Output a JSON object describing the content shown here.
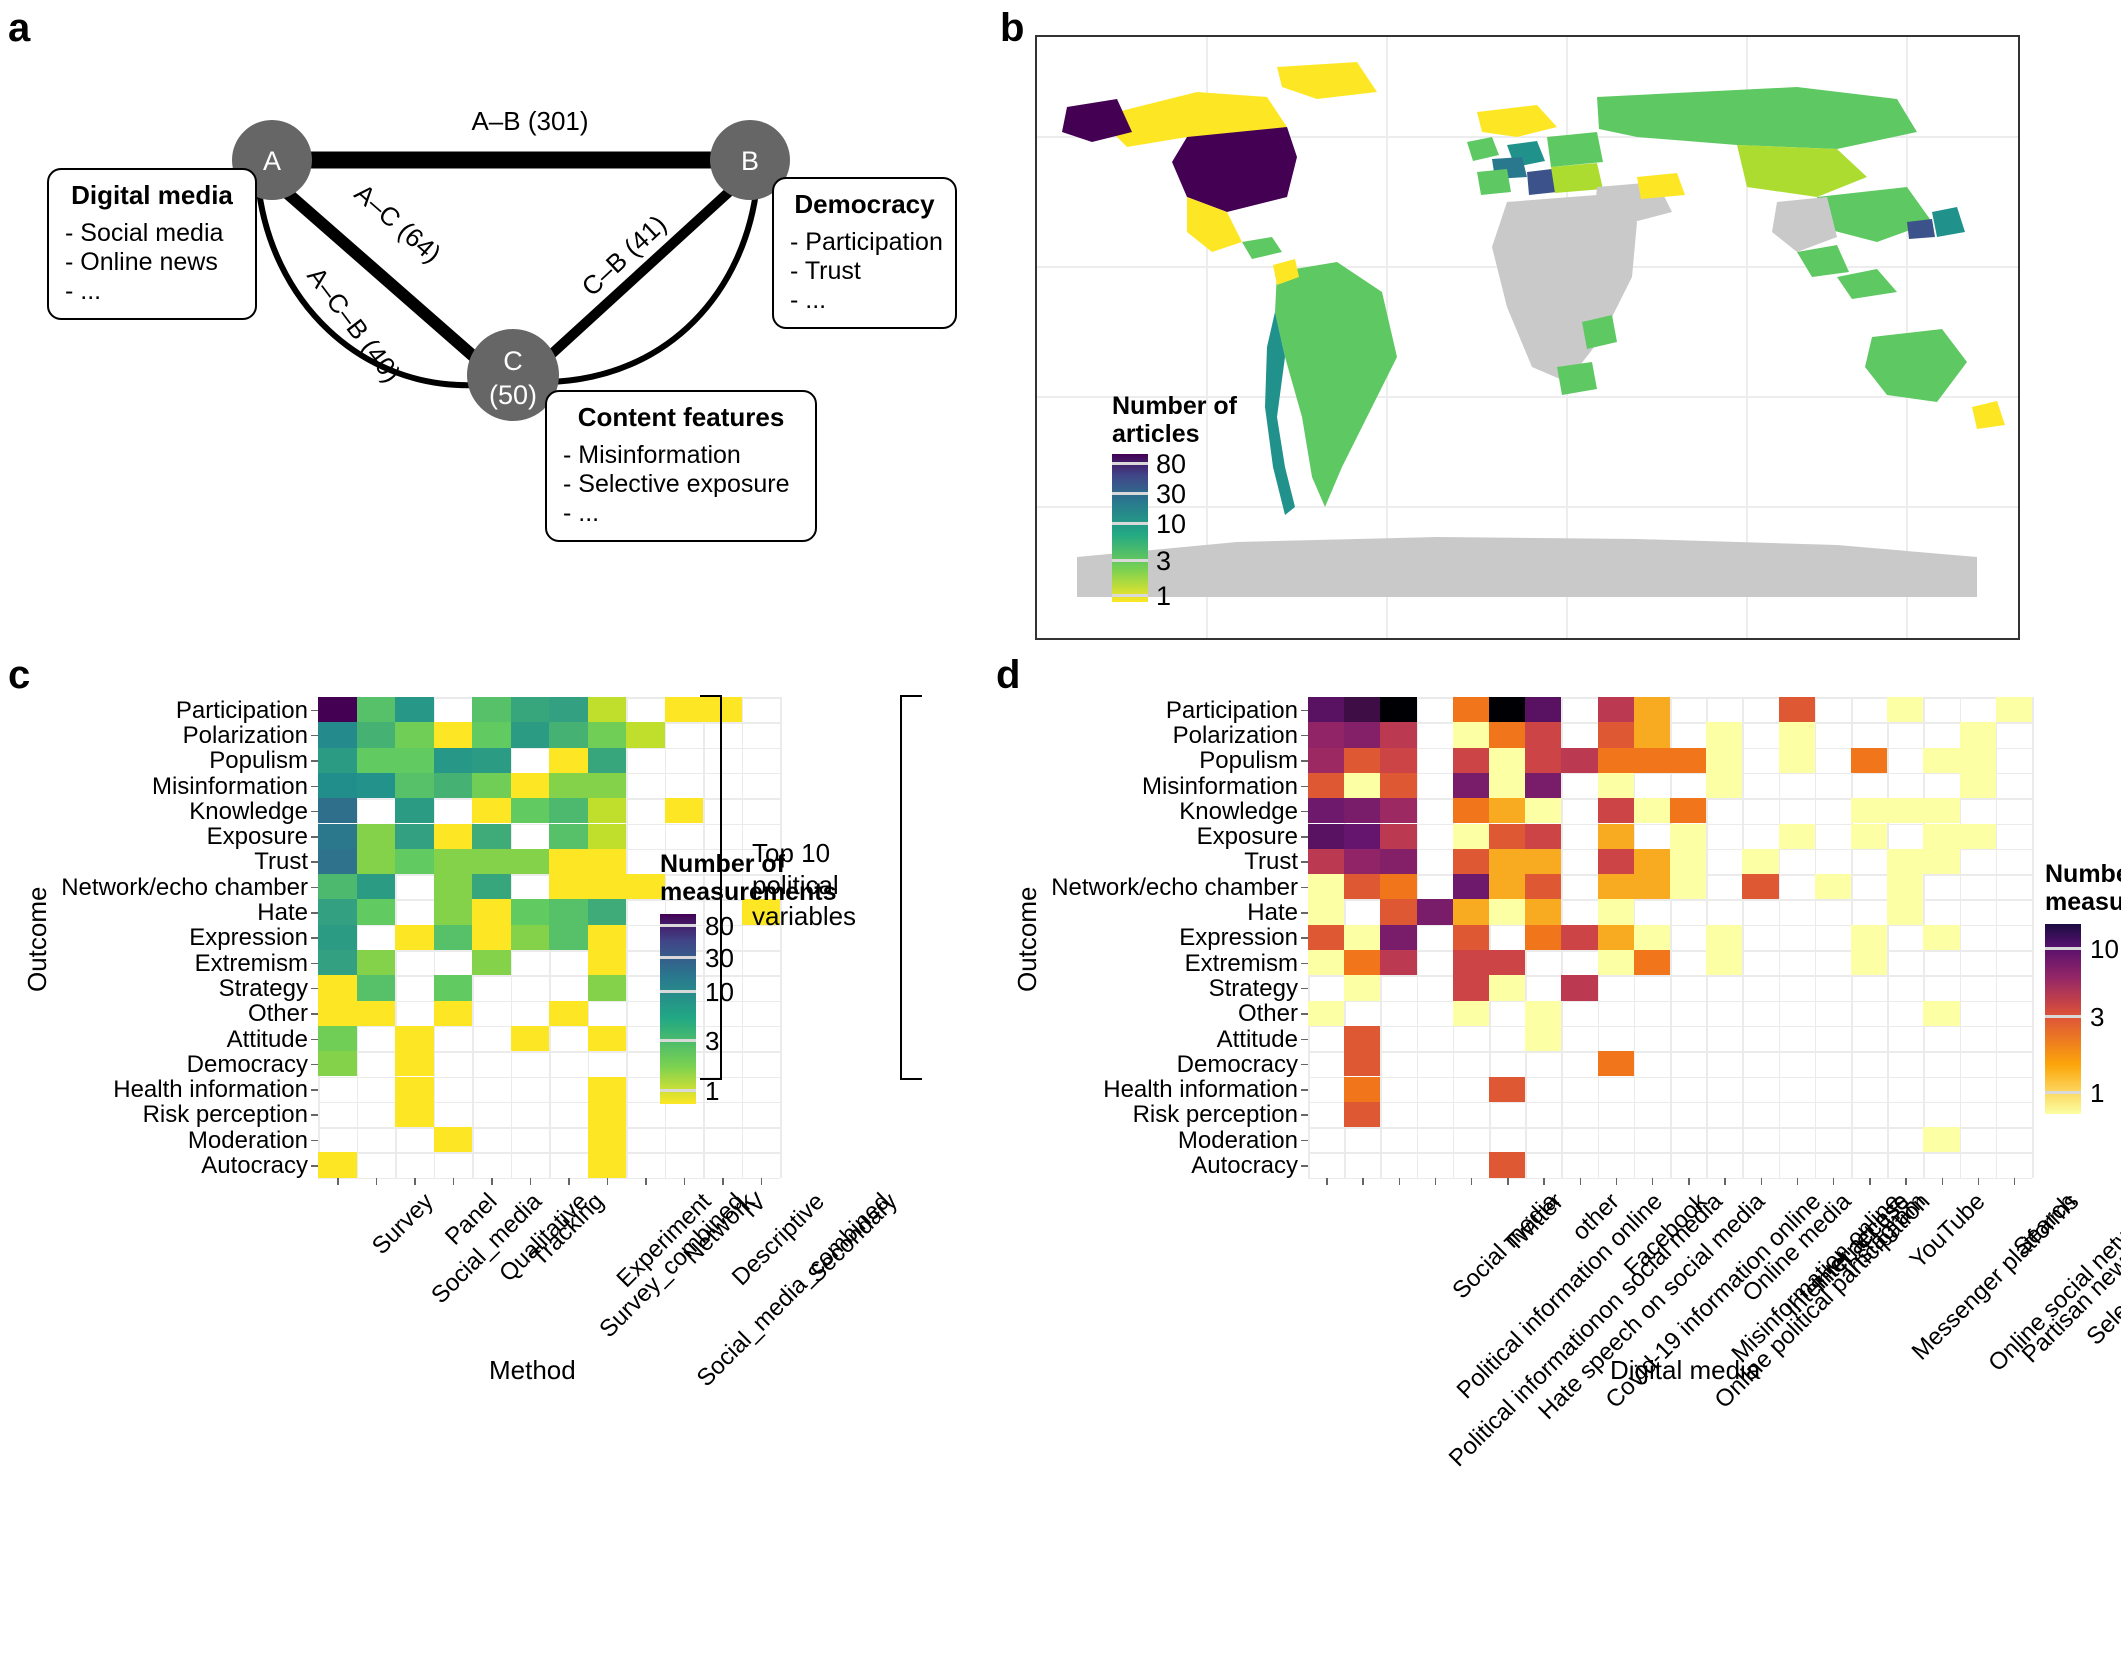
{
  "panels": {
    "a": {
      "letter": "a"
    },
    "b": {
      "letter": "b"
    },
    "c": {
      "letter": "c"
    },
    "d": {
      "letter": "d"
    }
  },
  "diagram": {
    "nodes": [
      {
        "id": "A",
        "label": "A",
        "sublabel": ""
      },
      {
        "id": "B",
        "label": "B",
        "sublabel": ""
      },
      {
        "id": "C",
        "label": "C",
        "sublabel": "(50)"
      }
    ],
    "edges": [
      {
        "id": "A-B",
        "label": "A–B (301)",
        "count": 301
      },
      {
        "id": "A-C",
        "label": "A–C (64)",
        "count": 64
      },
      {
        "id": "C-B",
        "label": "C–B (41)",
        "count": 41
      },
      {
        "id": "A-C-B",
        "label": "A–C–B (40)",
        "count": 40
      }
    ],
    "boxes": [
      {
        "title": "Digital media",
        "items": [
          "- Social media",
          "- Online news",
          "- ..."
        ]
      },
      {
        "title": "Democracy",
        "items": [
          "- Participation",
          "- Trust",
          "- ..."
        ]
      },
      {
        "title": "Content features",
        "items": [
          "- Misinformation",
          "- Selective exposure",
          "- ..."
        ]
      }
    ]
  },
  "map": {
    "legend": {
      "title_line1": "Number of",
      "title_line2": "articles",
      "ticks": [
        "80",
        "30",
        "10",
        "3",
        "1"
      ],
      "colors": [
        "#440154",
        "#414487",
        "#2a788e",
        "#22a884",
        "#7ad151",
        "#fde725"
      ]
    }
  },
  "bracket": {
    "text_line1": "Top 10",
    "text_line2": "political",
    "text_line3": "variables"
  },
  "chart_data": [
    {
      "type": "heatmap",
      "panel": "c",
      "title": "",
      "xlabel": "Method",
      "ylabel": "Outcome",
      "legend_title_line1": "Number of",
      "legend_title_line2": "measurements",
      "legend_ticks": [
        "80",
        "30",
        "10",
        "3",
        "1"
      ],
      "colorscale": "viridis",
      "xticklabels": [
        "Survey",
        "Social_media",
        "Panel",
        "Qualitative",
        "Tracking",
        "Survey_combined",
        "Experiment",
        "Social_media_combined",
        "Network",
        "Descriptive",
        "IV",
        "Secondary"
      ],
      "yticklabels": [
        "Participation",
        "Polarization",
        "Populism",
        "Misinformation",
        "Knowledge",
        "Exposure",
        "Trust",
        "Network/echo chamber",
        "Hate",
        "Expression",
        "Extremism",
        "Strategy",
        "Other",
        "Attitude",
        "Democracy",
        "Health information",
        "Risk perception",
        "Moderation",
        "Autocracy"
      ],
      "values": [
        [
          95,
          7,
          14,
          null,
          7,
          11,
          12,
          2,
          null,
          1,
          1,
          null
        ],
        [
          17,
          9,
          5,
          1,
          6,
          13,
          9,
          5,
          2,
          null,
          null,
          null
        ],
        [
          13,
          6,
          6,
          14,
          13,
          null,
          1,
          11,
          null,
          null,
          null,
          null
        ],
        [
          16,
          15,
          7,
          9,
          5,
          1,
          4,
          4,
          null,
          null,
          null,
          null
        ],
        [
          25,
          null,
          13,
          null,
          1,
          6,
          8,
          2,
          null,
          1,
          null,
          null
        ],
        [
          22,
          4,
          12,
          1,
          10,
          null,
          7,
          2,
          null,
          null,
          null,
          null
        ],
        [
          24,
          4,
          6,
          4,
          4,
          4,
          1,
          1,
          null,
          null,
          null,
          null
        ],
        [
          8,
          13,
          null,
          4,
          11,
          null,
          1,
          1,
          1,
          null,
          null,
          null
        ],
        [
          12,
          6,
          null,
          4,
          1,
          6,
          7,
          10,
          null,
          null,
          null,
          1
        ],
        [
          13,
          null,
          1,
          7,
          1,
          4,
          7,
          1,
          null,
          null,
          null,
          null
        ],
        [
          12,
          4,
          null,
          null,
          4,
          null,
          null,
          1,
          null,
          null,
          null,
          null
        ],
        [
          1,
          7,
          null,
          6,
          null,
          null,
          null,
          4,
          null,
          null,
          null,
          null
        ],
        [
          1,
          1,
          null,
          1,
          null,
          null,
          1,
          null,
          null,
          null,
          null,
          null
        ],
        [
          5,
          null,
          1,
          null,
          null,
          1,
          null,
          1,
          null,
          null,
          null,
          null
        ],
        [
          4,
          null,
          1,
          null,
          null,
          null,
          null,
          null,
          null,
          null,
          null,
          null
        ],
        [
          null,
          null,
          1,
          null,
          null,
          null,
          null,
          1,
          null,
          null,
          null,
          null
        ],
        [
          null,
          null,
          1,
          null,
          null,
          null,
          null,
          1,
          null,
          null,
          null,
          null
        ],
        [
          null,
          null,
          null,
          1,
          null,
          null,
          null,
          1,
          null,
          null,
          null,
          null
        ],
        [
          1,
          null,
          null,
          null,
          null,
          null,
          null,
          1,
          null,
          null,
          null,
          null
        ]
      ]
    },
    {
      "type": "heatmap",
      "panel": "d",
      "title": "",
      "xlabel": "Digital media",
      "ylabel": "Outcome",
      "legend_title_line1": "Number of",
      "legend_title_line2": "measurements",
      "legend_ticks": [
        "10",
        "3",
        "1"
      ],
      "colorscale": "inferno",
      "xticklabels": [
        "Political informationon social media",
        "Political information online",
        "Social media",
        "Hate speech on social media",
        "Twitter",
        "Covid-19 information online",
        "other",
        "Facebook",
        "Online political participation",
        "Misinformation online",
        "Online media",
        "Internet access",
        "Internet use",
        "Instagram",
        "Messenger platforms",
        "YouTube",
        "Online social networks",
        "Partisan news outlets",
        "Search",
        "Selective exposure"
      ],
      "yticklabels": [
        "Participation",
        "Polarization",
        "Populism",
        "Misinformation",
        "Knowledge",
        "Exposure",
        "Trust",
        "Network/echo chamber",
        "Hate",
        "Expression",
        "Extremism",
        "Strategy",
        "Other",
        "Attitude",
        "Democracy",
        "Health information",
        "Risk perception",
        "Moderation",
        "Autocracy"
      ],
      "values": [
        [
          14,
          16,
          22,
          null,
          3,
          22,
          14,
          null,
          6,
          2,
          null,
          null,
          null,
          4,
          null,
          null,
          1,
          null,
          null,
          1
        ],
        [
          9,
          10,
          6,
          null,
          1,
          3,
          5,
          null,
          4,
          2,
          null,
          1,
          null,
          1,
          null,
          null,
          null,
          null,
          1,
          null
        ],
        [
          8,
          4,
          5,
          null,
          5,
          1,
          5,
          6,
          3,
          3,
          3,
          1,
          null,
          1,
          null,
          3,
          null,
          1,
          1,
          null
        ],
        [
          4,
          1,
          4,
          null,
          11,
          1,
          11,
          null,
          1,
          null,
          null,
          1,
          null,
          null,
          null,
          null,
          null,
          null,
          1,
          null
        ],
        [
          12,
          11,
          8,
          null,
          3,
          2,
          1,
          null,
          5,
          1,
          3,
          null,
          null,
          null,
          null,
          1,
          1,
          1,
          null,
          null
        ],
        [
          14,
          13,
          6,
          null,
          1,
          4,
          5,
          null,
          2,
          null,
          1,
          null,
          null,
          1,
          null,
          1,
          null,
          1,
          1,
          null
        ],
        [
          6,
          9,
          10,
          null,
          4,
          2,
          2,
          null,
          5,
          2,
          1,
          null,
          1,
          null,
          null,
          null,
          1,
          1,
          null,
          null
        ],
        [
          1,
          4,
          3,
          null,
          12,
          2,
          4,
          null,
          2,
          2,
          1,
          null,
          4,
          null,
          1,
          null,
          1,
          null,
          null,
          null
        ],
        [
          1,
          null,
          4,
          11,
          2,
          1,
          2,
          null,
          1,
          null,
          null,
          null,
          null,
          null,
          null,
          null,
          1,
          null,
          null,
          null
        ],
        [
          4,
          1,
          11,
          null,
          4,
          null,
          3,
          5,
          2,
          1,
          null,
          1,
          null,
          null,
          null,
          1,
          null,
          1,
          null,
          null
        ],
        [
          1,
          3,
          6,
          null,
          5,
          5,
          null,
          null,
          1,
          3,
          null,
          1,
          null,
          null,
          null,
          1,
          null,
          null,
          null,
          null
        ],
        [
          null,
          1,
          null,
          null,
          5,
          1,
          null,
          6,
          null,
          null,
          null,
          null,
          null,
          null,
          null,
          null,
          null,
          null,
          null,
          null
        ],
        [
          1,
          null,
          null,
          null,
          1,
          null,
          1,
          null,
          null,
          null,
          null,
          null,
          null,
          null,
          null,
          null,
          null,
          1,
          null,
          null
        ],
        [
          null,
          4,
          null,
          null,
          null,
          null,
          1,
          null,
          null,
          null,
          null,
          null,
          null,
          null,
          null,
          null,
          null,
          null,
          null,
          null
        ],
        [
          null,
          4,
          null,
          null,
          null,
          null,
          null,
          null,
          3,
          null,
          null,
          null,
          null,
          null,
          null,
          null,
          null,
          null,
          null,
          null
        ],
        [
          null,
          3,
          null,
          null,
          null,
          4,
          null,
          null,
          null,
          null,
          null,
          null,
          null,
          null,
          null,
          null,
          null,
          null,
          null,
          null
        ],
        [
          null,
          4,
          null,
          null,
          null,
          null,
          null,
          null,
          null,
          null,
          null,
          null,
          null,
          null,
          null,
          null,
          null,
          null,
          null,
          null
        ],
        [
          null,
          null,
          null,
          null,
          null,
          null,
          null,
          null,
          null,
          null,
          null,
          null,
          null,
          null,
          null,
          null,
          null,
          1,
          null,
          null
        ],
        [
          null,
          null,
          null,
          null,
          null,
          4,
          null,
          null,
          null,
          null,
          null,
          null,
          null,
          null,
          null,
          null,
          null,
          null,
          null,
          null
        ]
      ]
    }
  ]
}
